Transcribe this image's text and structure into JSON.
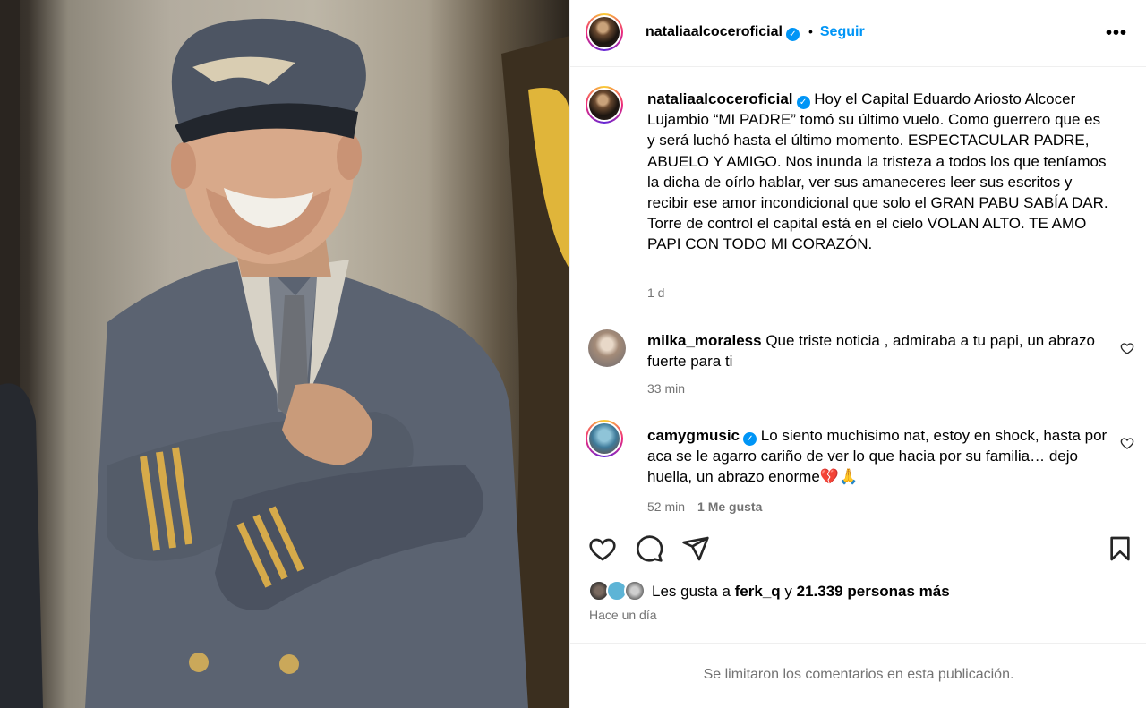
{
  "post": {
    "author": "nataliaalcoceroficial",
    "verified": true,
    "follow_label": "Seguir",
    "more_label": "•••",
    "dot": "•"
  },
  "caption": {
    "username": "nataliaalcoceroficial",
    "text": "Hoy el Capital Eduardo Ariosto Alcocer Lujambio “MI PADRE” tomó su último vuelo. Como guerrero que es y será luchó hasta el último momento. ESPECTACULAR PADRE, ABUELO Y AMIGO. Nos inunda la tristeza a todos los que teníamos la dicha de oírlo hablar, ver sus amaneceres leer sus escritos y recibir ese amor incondicional que solo el GRAN PABU SABÍA DAR. Torre de control el capital está en el cielo VOLAN ALTO. TE AMO PAPI CON TODO MI CORAZÓN.",
    "time": "1 d"
  },
  "comments": [
    {
      "username": "milka_moraless",
      "verified": false,
      "text": "Que triste noticia , admiraba a tu papi, un abrazo fuerte para ti",
      "time": "33 min",
      "likes": ""
    },
    {
      "username": "camygmusic",
      "verified": true,
      "text": "Lo siento muchisimo nat, estoy en shock, hasta por aca se le agarro cariño de ver lo que hacia por su familia… dejo huella, un abrazo enorme💔🙏",
      "time": "52 min",
      "likes": "1 Me gusta"
    }
  ],
  "likes_summary": {
    "prefix": "Les gusta a",
    "user": "ferk_q",
    "joiner": "y",
    "count_text": "21.339 personas más"
  },
  "posted_ago": "Hace un día",
  "comments_limited": "Se limitaron los comentarios en esta publicación.",
  "colors": {
    "accent": "#0095f6",
    "muted": "#737373",
    "divider": "#efefef"
  },
  "icons": [
    "heart-icon",
    "comment-icon",
    "share-icon",
    "bookmark-icon",
    "more-icon",
    "verified-icon"
  ]
}
